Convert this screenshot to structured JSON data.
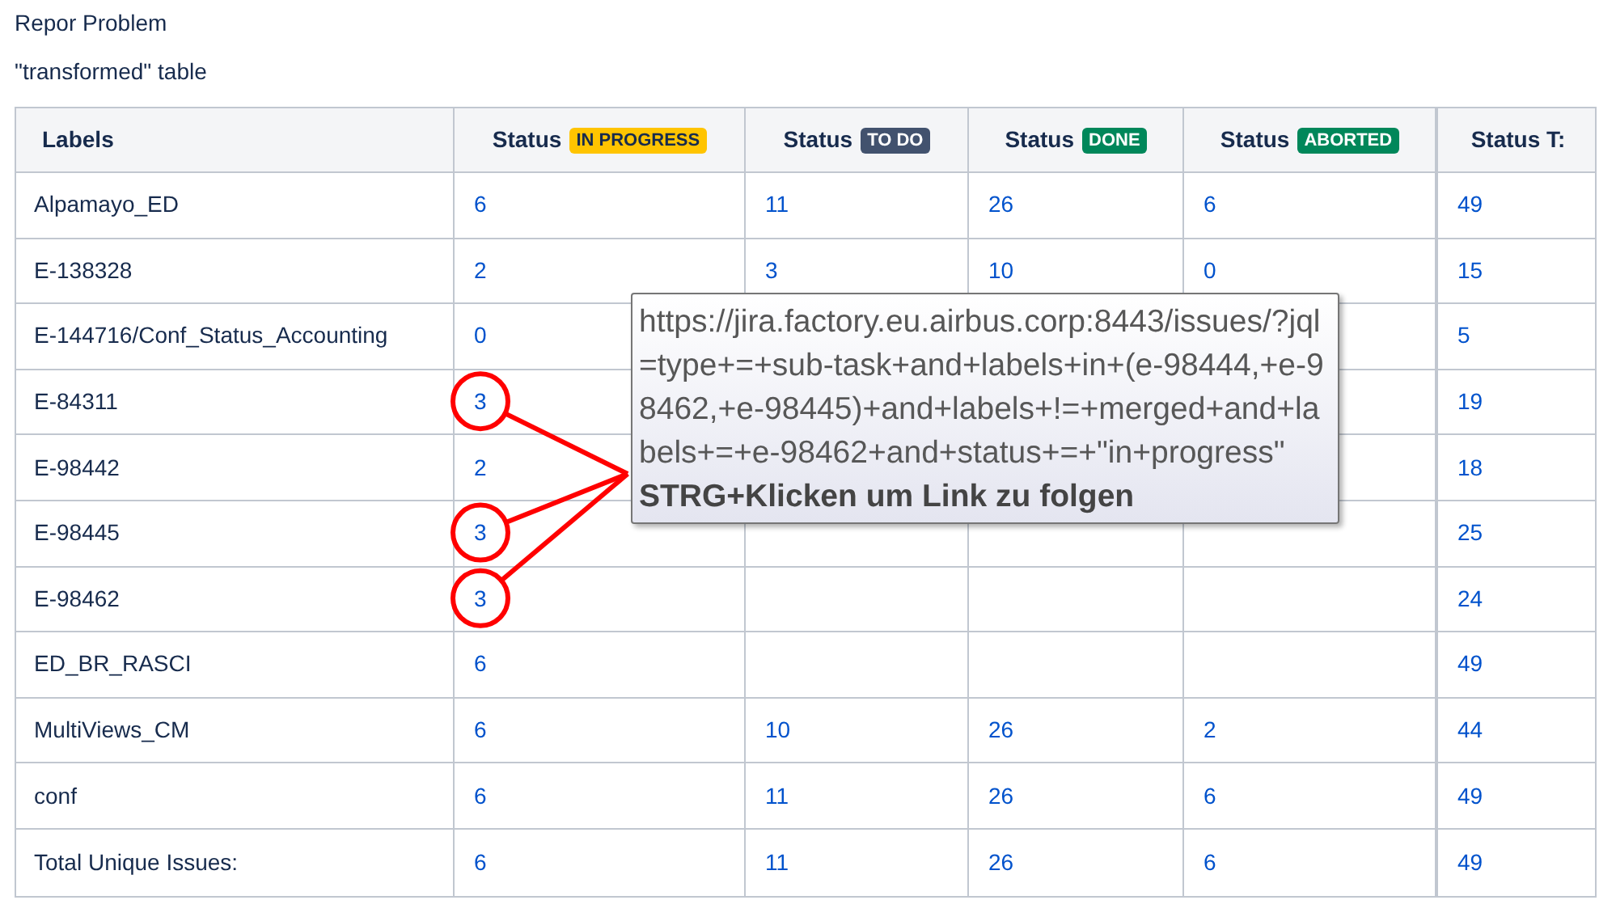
{
  "title": "Repor Problem",
  "subtitle": "\"transformed\" table",
  "table": {
    "columns": [
      {
        "label": "Labels"
      },
      {
        "label": "Status",
        "badge": "IN PROGRESS",
        "kind": "current"
      },
      {
        "label": "Status",
        "badge": "TO DO",
        "kind": "new"
      },
      {
        "label": "Status",
        "badge": "DONE",
        "kind": "success"
      },
      {
        "label": "Status",
        "badge": "ABORTED",
        "kind": "success"
      },
      {
        "label": "Status T:"
      }
    ],
    "rows": [
      {
        "label": "Alpamayo_ED",
        "in_progress": "6",
        "to_do": "11",
        "done": "26",
        "aborted": "6",
        "total": "49",
        "circled": false
      },
      {
        "label": "E-138328",
        "in_progress": "2",
        "to_do": "3",
        "done": "10",
        "aborted": "0",
        "total": "15",
        "circled": false
      },
      {
        "label": "E-144716/Conf_Status_Accounting",
        "in_progress": "0",
        "total": "5",
        "circled": false
      },
      {
        "label": "E-84311",
        "in_progress": "3",
        "total": "19",
        "circled": true
      },
      {
        "label": "E-98442",
        "in_progress": "2",
        "total": "18",
        "circled": false
      },
      {
        "label": "E-98445",
        "in_progress": "3",
        "total": "25",
        "circled": true
      },
      {
        "label": "E-98462",
        "in_progress": "3",
        "total": "24",
        "circled": true
      },
      {
        "label": "ED_BR_RASCI",
        "in_progress": "6",
        "total": "49",
        "circled": false
      },
      {
        "label": "MultiViews_CM",
        "in_progress": "6",
        "to_do": "10",
        "done": "26",
        "aborted": "2",
        "total": "44",
        "circled": false
      },
      {
        "label": "conf",
        "in_progress": "6",
        "to_do": "11",
        "done": "26",
        "aborted": "6",
        "total": "49",
        "circled": false
      },
      {
        "label": "Total Unique Issues:",
        "in_progress": "6",
        "to_do": "11",
        "done": "26",
        "aborted": "6",
        "total": "49",
        "circled": false
      }
    ]
  },
  "tooltip": {
    "url": "https://jira.factory.eu.airbus.corp:8443/issues/?jql=type+=+sub-task+and+labels+in+(e-98444,+e-98462,+e-98445)+and+labels+!=+merged+and+labels+=+e-98462+and+status+=+\"in+progress\"",
    "hint": "STRG+Klicken um Link zu folgen"
  }
}
